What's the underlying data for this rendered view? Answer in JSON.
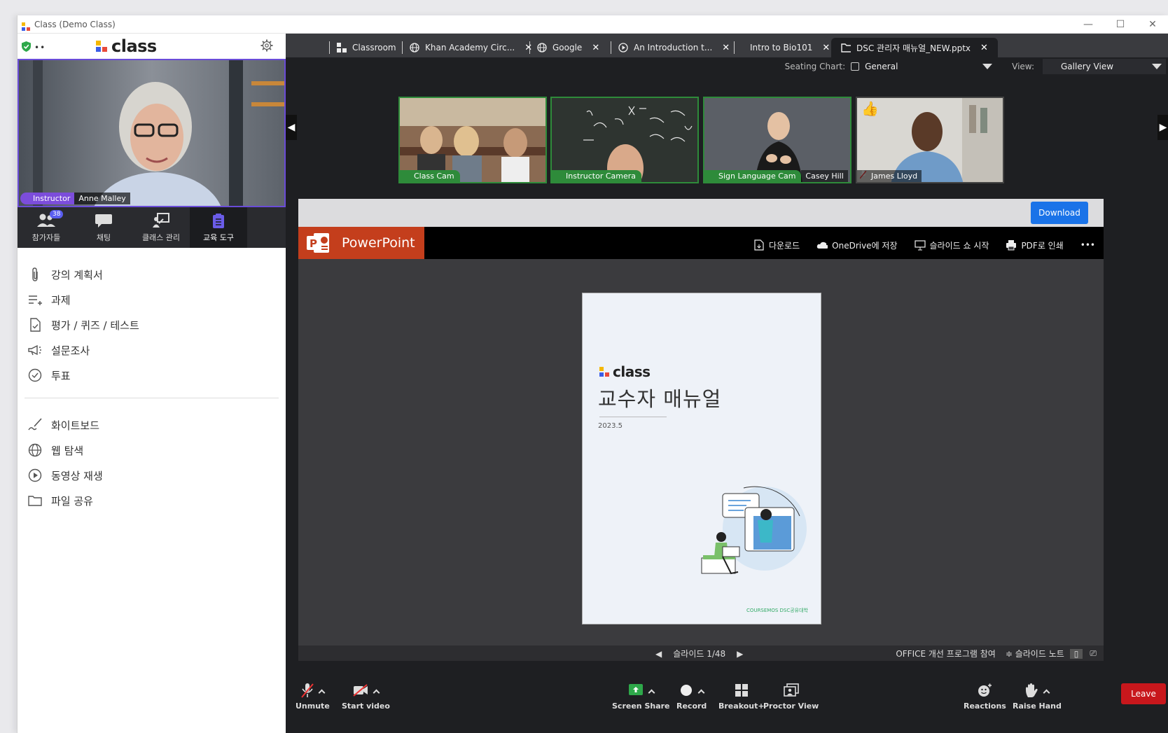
{
  "window": {
    "title": "Class (Demo Class)",
    "controls": [
      "minimize",
      "maximize",
      "close"
    ]
  },
  "brand": {
    "name": "class"
  },
  "main_video": {
    "role": "Instructor",
    "name": "Anne Malley"
  },
  "left_tabs": [
    {
      "label": "참가자들",
      "badge": "38",
      "icon": "participants-icon"
    },
    {
      "label": "채팅",
      "icon": "chat-icon"
    },
    {
      "label": "클래스 관리",
      "icon": "class-manage-icon"
    },
    {
      "label": "교육 도구",
      "icon": "tools-icon",
      "active": true
    }
  ],
  "menu_group1": [
    {
      "label": "강의 계획서",
      "icon": "paperclip-icon"
    },
    {
      "label": "과제",
      "icon": "assignment-icon"
    },
    {
      "label": "평가 / 퀴즈 / 테스트",
      "icon": "quiz-icon"
    },
    {
      "label": "설문조사",
      "icon": "megaphone-icon"
    },
    {
      "label": "투표",
      "icon": "check-circle-icon"
    }
  ],
  "menu_group2": [
    {
      "label": "화이트보드",
      "icon": "pen-icon"
    },
    {
      "label": "웹 탐색",
      "icon": "globe-icon"
    },
    {
      "label": "동영상 재생",
      "icon": "play-circle-icon"
    },
    {
      "label": "파일 공유",
      "icon": "folder-icon"
    }
  ],
  "tabs": [
    {
      "label": "Classroom",
      "icon": "classroom-icon",
      "closable": false
    },
    {
      "label": "Khan Academy Circ...",
      "icon": "globe-icon",
      "closable": true
    },
    {
      "label": "Google",
      "icon": "globe-icon",
      "closable": true
    },
    {
      "label": "An Introduction t...",
      "icon": "play-icon",
      "closable": true
    },
    {
      "label": "Intro to Bio101",
      "icon": "none",
      "closable": true
    },
    {
      "label": "DSC 관리자 매뉴얼_NEW.pptx",
      "icon": "folder-icon",
      "closable": true,
      "active": true
    }
  ],
  "subbar": {
    "seating_label": "Seating Chart:",
    "seating_value": "General",
    "view_label": "View:",
    "view_value": "Gallery View"
  },
  "gallery": [
    {
      "label": "Class Cam",
      "name": ""
    },
    {
      "label": "Instructor Camera",
      "name": ""
    },
    {
      "label": "Sign Language Cam",
      "name": "Casey Hill"
    },
    {
      "label": "",
      "name": "James Lloyd"
    }
  ],
  "download_label": "Download",
  "ppt": {
    "app_name": "PowerPoint",
    "tools": [
      {
        "label": "다운로드",
        "icon": "download-icon"
      },
      {
        "label": "OneDrive에 저장",
        "icon": "cloud-icon"
      },
      {
        "label": "슬라이드 쇼 시작",
        "icon": "slideshow-icon"
      },
      {
        "label": "PDF로 인쇄",
        "icon": "print-icon"
      }
    ],
    "more": "•••",
    "slide": {
      "brand": "class",
      "title": "교수자  매뉴얼",
      "date": "2023.5",
      "footer": "COURSEMOS  DSC공유대학"
    },
    "status": {
      "slide_label": "슬라이드 1/48",
      "feedback": "OFFICE 개선 프로그램 참여",
      "notes": "≑ 슬라이드 노트"
    }
  },
  "bottom": {
    "unmute": "Unmute",
    "start_video": "Start video",
    "screen_share": "Screen Share",
    "record": "Record",
    "breakout": "Breakout+",
    "proctor": "Proctor View",
    "reactions": "Reactions",
    "raise_hand": "Raise Hand",
    "leave": "Leave"
  },
  "colors": {
    "accent": "#6a4cd8",
    "cam_green": "#2e8b3a",
    "ppt_red": "#c43e1c",
    "leave_red": "#c8171c",
    "download_blue": "#1a73e8"
  }
}
